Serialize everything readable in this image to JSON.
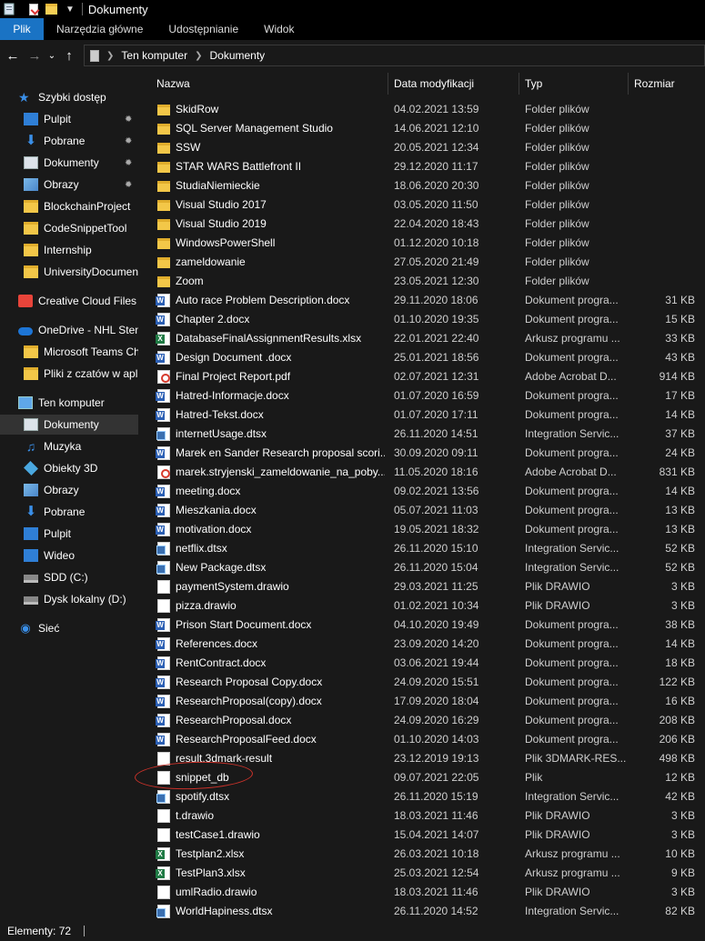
{
  "window": {
    "title": "Dokumenty"
  },
  "ribbon": {
    "tabs": [
      {
        "label": "Plik"
      },
      {
        "label": "Narzędzia główne"
      },
      {
        "label": "Udostępnianie"
      },
      {
        "label": "Widok"
      }
    ]
  },
  "address": {
    "crumbs": [
      {
        "label": "Ten komputer"
      },
      {
        "label": "Dokumenty"
      }
    ]
  },
  "nav": {
    "items": [
      {
        "label": "Szybki dostęp",
        "icon": "star-icon",
        "pinned": false,
        "indent": 1
      },
      {
        "label": "Pulpit",
        "icon": "desktop-icon",
        "pinned": true,
        "indent": 2
      },
      {
        "label": "Pobrane",
        "icon": "download-icon",
        "pinned": true,
        "indent": 2
      },
      {
        "label": "Dokumenty",
        "icon": "documents-icon",
        "pinned": true,
        "indent": 2
      },
      {
        "label": "Obrazy",
        "icon": "pictures-icon",
        "pinned": true,
        "indent": 2
      },
      {
        "label": "BlockchainProject",
        "icon": "folder-icon",
        "pinned": false,
        "indent": 2
      },
      {
        "label": "CodeSnippetTool",
        "icon": "folder-icon",
        "pinned": false,
        "indent": 2
      },
      {
        "label": "Internship",
        "icon": "folder-icon",
        "pinned": false,
        "indent": 2
      },
      {
        "label": "UniversityDocumen",
        "icon": "folder-icon",
        "pinned": false,
        "indent": 2
      },
      {
        "label": "Creative Cloud Files",
        "icon": "creative-cloud-icon",
        "pinned": false,
        "indent": 1
      },
      {
        "label": "OneDrive - NHL Sten",
        "icon": "onedrive-icon",
        "pinned": false,
        "indent": 1
      },
      {
        "label": "Microsoft Teams Ch",
        "icon": "folder-icon",
        "pinned": false,
        "indent": 2
      },
      {
        "label": "Pliki z czatów w apli",
        "icon": "folder-icon",
        "pinned": false,
        "indent": 2
      },
      {
        "label": "Ten komputer",
        "icon": "computer-icon",
        "pinned": false,
        "indent": 1
      },
      {
        "label": "Dokumenty",
        "icon": "documents-icon",
        "pinned": false,
        "indent": 2,
        "selected": true
      },
      {
        "label": "Muzyka",
        "icon": "music-icon",
        "pinned": false,
        "indent": 2
      },
      {
        "label": "Obiekty 3D",
        "icon": "cube-icon",
        "pinned": false,
        "indent": 2
      },
      {
        "label": "Obrazy",
        "icon": "pictures-icon",
        "pinned": false,
        "indent": 2
      },
      {
        "label": "Pobrane",
        "icon": "download-icon",
        "pinned": false,
        "indent": 2
      },
      {
        "label": "Pulpit",
        "icon": "desktop-icon",
        "pinned": false,
        "indent": 2
      },
      {
        "label": "Wideo",
        "icon": "video-icon",
        "pinned": false,
        "indent": 2
      },
      {
        "label": "SDD (C:)",
        "icon": "drive-icon",
        "pinned": false,
        "indent": 2
      },
      {
        "label": "Dysk lokalny (D:)",
        "icon": "drive-icon",
        "pinned": false,
        "indent": 2
      },
      {
        "label": "Sieć",
        "icon": "network-icon",
        "pinned": false,
        "indent": 1
      }
    ]
  },
  "columns": {
    "name": "Nazwa",
    "date": "Data modyfikacji",
    "type": "Typ",
    "size": "Rozmiar"
  },
  "files": [
    {
      "name": "SkidRow",
      "date": "04.02.2021 13:59",
      "type": "Folder plików",
      "size": "",
      "icon": "folder-icon"
    },
    {
      "name": "SQL Server Management Studio",
      "date": "14.06.2021 12:10",
      "type": "Folder plików",
      "size": "",
      "icon": "folder-icon"
    },
    {
      "name": "SSW",
      "date": "20.05.2021 12:34",
      "type": "Folder plików",
      "size": "",
      "icon": "folder-icon"
    },
    {
      "name": "STAR WARS Battlefront II",
      "date": "29.12.2020 11:17",
      "type": "Folder plików",
      "size": "",
      "icon": "folder-icon"
    },
    {
      "name": "StudiaNiemieckie",
      "date": "18.06.2020 20:30",
      "type": "Folder plików",
      "size": "",
      "icon": "folder-icon"
    },
    {
      "name": "Visual Studio 2017",
      "date": "03.05.2020 11:50",
      "type": "Folder plików",
      "size": "",
      "icon": "folder-icon"
    },
    {
      "name": "Visual Studio 2019",
      "date": "22.04.2020 18:43",
      "type": "Folder plików",
      "size": "",
      "icon": "folder-icon"
    },
    {
      "name": "WindowsPowerShell",
      "date": "01.12.2020 10:18",
      "type": "Folder plików",
      "size": "",
      "icon": "folder-icon"
    },
    {
      "name": "zameldowanie",
      "date": "27.05.2020 21:49",
      "type": "Folder plików",
      "size": "",
      "icon": "folder-icon"
    },
    {
      "name": "Zoom",
      "date": "23.05.2021 12:30",
      "type": "Folder plików",
      "size": "",
      "icon": "folder-icon"
    },
    {
      "name": "Auto race Problem Description.docx",
      "date": "29.11.2020 18:06",
      "type": "Dokument progra...",
      "size": "31 KB",
      "icon": "word-icon"
    },
    {
      "name": "Chapter 2.docx",
      "date": "01.10.2020 19:35",
      "type": "Dokument progra...",
      "size": "15 KB",
      "icon": "word-icon"
    },
    {
      "name": "DatabaseFinalAssignmentResults.xlsx",
      "date": "22.01.2021 22:40",
      "type": "Arkusz programu ...",
      "size": "33 KB",
      "icon": "excel-icon"
    },
    {
      "name": "Design Document .docx",
      "date": "25.01.2021 18:56",
      "type": "Dokument progra...",
      "size": "43 KB",
      "icon": "word-icon"
    },
    {
      "name": "Final Project Report.pdf",
      "date": "02.07.2021 12:31",
      "type": "Adobe Acrobat D...",
      "size": "914 KB",
      "icon": "pdf-icon"
    },
    {
      "name": "Hatred-Informacje.docx",
      "date": "01.07.2020 16:59",
      "type": "Dokument progra...",
      "size": "17 KB",
      "icon": "word-icon"
    },
    {
      "name": "Hatred-Tekst.docx",
      "date": "01.07.2020 17:11",
      "type": "Dokument progra...",
      "size": "14 KB",
      "icon": "word-icon"
    },
    {
      "name": "internetUsage.dtsx",
      "date": "26.11.2020 14:51",
      "type": "Integration Servic...",
      "size": "37 KB",
      "icon": "dtsx-icon"
    },
    {
      "name": "Marek en Sander Research proposal scori...",
      "date": "30.09.2020 09:11",
      "type": "Dokument progra...",
      "size": "24 KB",
      "icon": "word-icon"
    },
    {
      "name": "marek.stryjenski_zameldowanie_na_poby...",
      "date": "11.05.2020 18:16",
      "type": "Adobe Acrobat D...",
      "size": "831 KB",
      "icon": "pdf-icon"
    },
    {
      "name": "meeting.docx",
      "date": "09.02.2021 13:56",
      "type": "Dokument progra...",
      "size": "14 KB",
      "icon": "word-icon"
    },
    {
      "name": "Mieszkania.docx",
      "date": "05.07.2021 11:03",
      "type": "Dokument progra...",
      "size": "13 KB",
      "icon": "word-icon"
    },
    {
      "name": "motivation.docx",
      "date": "19.05.2021 18:32",
      "type": "Dokument progra...",
      "size": "13 KB",
      "icon": "word-icon"
    },
    {
      "name": "netflix.dtsx",
      "date": "26.11.2020 15:10",
      "type": "Integration Servic...",
      "size": "52 KB",
      "icon": "dtsx-icon"
    },
    {
      "name": "New Package.dtsx",
      "date": "26.11.2020 15:04",
      "type": "Integration Servic...",
      "size": "52 KB",
      "icon": "dtsx-icon"
    },
    {
      "name": "paymentSystem.drawio",
      "date": "29.03.2021 11:25",
      "type": "Plik DRAWIO",
      "size": "3 KB",
      "icon": "blank-file-icon"
    },
    {
      "name": "pizza.drawio",
      "date": "01.02.2021 10:34",
      "type": "Plik DRAWIO",
      "size": "3 KB",
      "icon": "blank-file-icon"
    },
    {
      "name": "Prison Start Document.docx",
      "date": "04.10.2020 19:49",
      "type": "Dokument progra...",
      "size": "38 KB",
      "icon": "word-icon"
    },
    {
      "name": "References.docx",
      "date": "23.09.2020 14:20",
      "type": "Dokument progra...",
      "size": "14 KB",
      "icon": "word-icon"
    },
    {
      "name": "RentContract.docx",
      "date": "03.06.2021 19:44",
      "type": "Dokument progra...",
      "size": "18 KB",
      "icon": "word-icon"
    },
    {
      "name": "Research Proposal Copy.docx",
      "date": "24.09.2020 15:51",
      "type": "Dokument progra...",
      "size": "122 KB",
      "icon": "word-icon"
    },
    {
      "name": "ResearchProposal(copy).docx",
      "date": "17.09.2020 18:04",
      "type": "Dokument progra...",
      "size": "16 KB",
      "icon": "word-icon"
    },
    {
      "name": "ResearchProposal.docx",
      "date": "24.09.2020 16:29",
      "type": "Dokument progra...",
      "size": "208 KB",
      "icon": "word-icon"
    },
    {
      "name": "ResearchProposalFeed.docx",
      "date": "01.10.2020 14:03",
      "type": "Dokument progra...",
      "size": "206 KB",
      "icon": "word-icon"
    },
    {
      "name": "result.3dmark-result",
      "date": "23.12.2019 19:13",
      "type": "Plik 3DMARK-RES...",
      "size": "498 KB",
      "icon": "blank-file-icon"
    },
    {
      "name": "snippet_db",
      "date": "09.07.2021 22:05",
      "type": "Plik",
      "size": "12 KB",
      "icon": "blank-file-icon",
      "annotated": true
    },
    {
      "name": "spotify.dtsx",
      "date": "26.11.2020 15:19",
      "type": "Integration Servic...",
      "size": "42 KB",
      "icon": "dtsx-icon"
    },
    {
      "name": "t.drawio",
      "date": "18.03.2021 11:46",
      "type": "Plik DRAWIO",
      "size": "3 KB",
      "icon": "blank-file-icon"
    },
    {
      "name": "testCase1.drawio",
      "date": "15.04.2021 14:07",
      "type": "Plik DRAWIO",
      "size": "3 KB",
      "icon": "blank-file-icon"
    },
    {
      "name": "Testplan2.xlsx",
      "date": "26.03.2021 10:18",
      "type": "Arkusz programu ...",
      "size": "10 KB",
      "icon": "excel-icon"
    },
    {
      "name": "TestPlan3.xlsx",
      "date": "25.03.2021 12:54",
      "type": "Arkusz programu ...",
      "size": "9 KB",
      "icon": "excel-icon"
    },
    {
      "name": "umlRadio.drawio",
      "date": "18.03.2021 11:46",
      "type": "Plik DRAWIO",
      "size": "3 KB",
      "icon": "blank-file-icon"
    },
    {
      "name": "WorldHapiness.dtsx",
      "date": "26.11.2020 14:52",
      "type": "Integration Servic...",
      "size": "82 KB",
      "icon": "dtsx-icon"
    }
  ],
  "status": {
    "count_text": "Elementy: 72"
  },
  "colors": {
    "accent": "#1a73c4",
    "background": "#191919",
    "annotation": "#c9322a"
  }
}
